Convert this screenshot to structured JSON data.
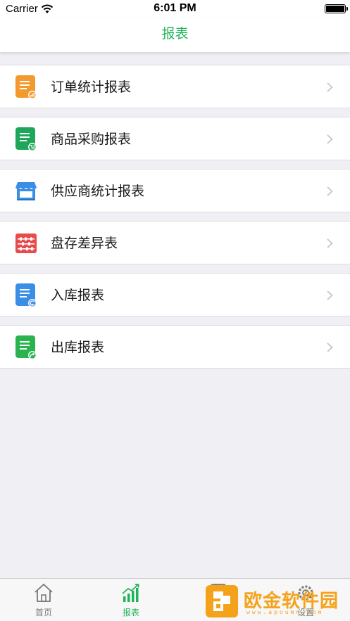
{
  "status_bar": {
    "carrier": "Carrier",
    "time": "6:01 PM"
  },
  "nav": {
    "title": "报表"
  },
  "accent_color": "#1fb45a",
  "report_items": [
    {
      "label": "订单统计报表",
      "icon": "order-report-icon",
      "color": "#f29a2e"
    },
    {
      "label": "商品采购报表",
      "icon": "purchase-report-icon",
      "color": "#1ea65a"
    },
    {
      "label": "供应商统计报表",
      "icon": "supplier-store-icon",
      "color": "#3a8ee6"
    },
    {
      "label": "盘存差异表",
      "icon": "abacus-icon",
      "color": "#e84b4b"
    },
    {
      "label": "入库报表",
      "icon": "inbound-report-icon",
      "color": "#3a8ee6"
    },
    {
      "label": "出库报表",
      "icon": "outbound-report-icon",
      "color": "#2bb34f"
    }
  ],
  "tabs": [
    {
      "label": "首页",
      "icon": "home-icon",
      "active": false
    },
    {
      "label": "报表",
      "icon": "bar-chart-icon",
      "active": true
    },
    {
      "label": "",
      "icon": "tab-icon",
      "active": false
    },
    {
      "label": "设置",
      "icon": "gear-icon",
      "active": false
    }
  ],
  "watermark": {
    "text": "欧金软件园",
    "subtext": "www.apoumn.com"
  }
}
